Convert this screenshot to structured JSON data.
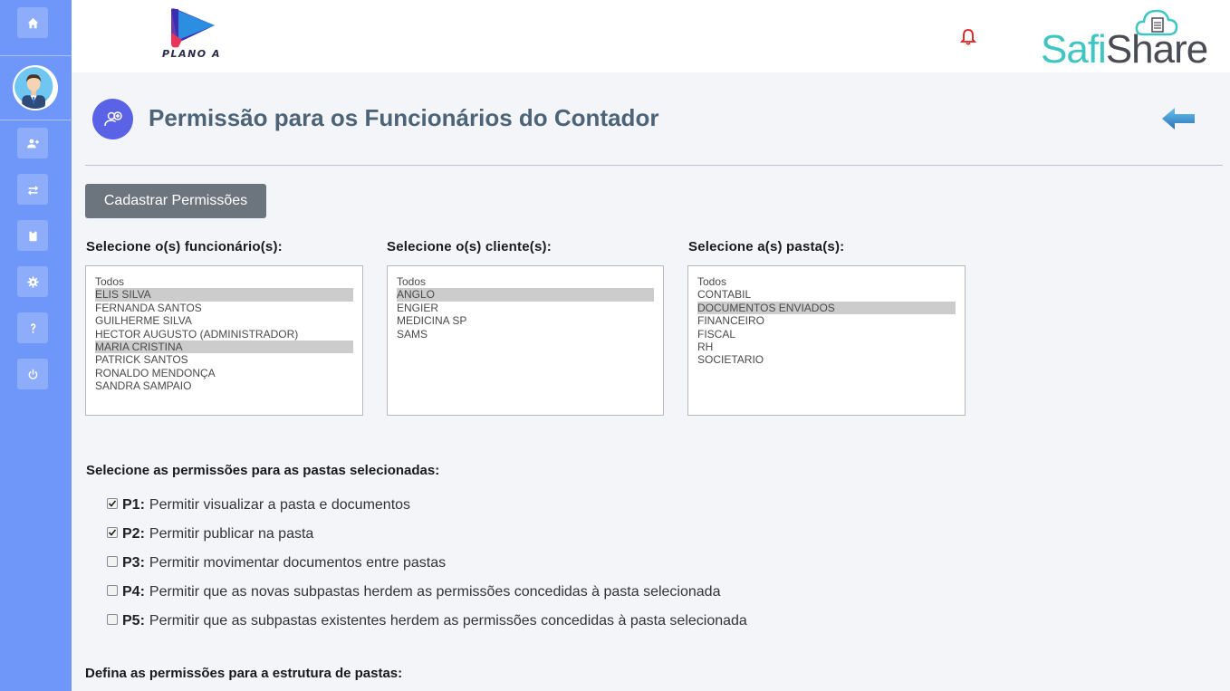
{
  "header": {
    "brand_left": "PLANO A",
    "brand_right_a": "Safi",
    "brand_right_b": "Share"
  },
  "sidebar": {
    "items": [
      {
        "icon": "home-icon"
      },
      {
        "icon": "add-user-icon"
      },
      {
        "icon": "transfer-icon"
      },
      {
        "icon": "clipboard-icon"
      },
      {
        "icon": "gear-icon"
      },
      {
        "icon": "question-icon"
      },
      {
        "icon": "power-icon"
      }
    ]
  },
  "page": {
    "title": "Permissão para os Funcionários do Contador",
    "register_button": "Cadastrar Permissões"
  },
  "employees": {
    "label": "Selecione o(s) funcionário(s):",
    "options": [
      {
        "text": "Todos",
        "selected": false
      },
      {
        "text": "ELIS SILVA",
        "selected": true
      },
      {
        "text": "FERNANDA SANTOS",
        "selected": false
      },
      {
        "text": "GUILHERME SILVA",
        "selected": false
      },
      {
        "text": "HECTOR AUGUSTO (ADMINISTRADOR)",
        "selected": false
      },
      {
        "text": "MARIA CRISTINA",
        "selected": true
      },
      {
        "text": "PATRICK SANTOS",
        "selected": false
      },
      {
        "text": "RONALDO MENDONÇA",
        "selected": false
      },
      {
        "text": "SANDRA SAMPAIO",
        "selected": false
      }
    ]
  },
  "clients": {
    "label": "Selecione o(s) cliente(s):",
    "options": [
      {
        "text": "Todos",
        "selected": false
      },
      {
        "text": "ANGLO",
        "selected": true
      },
      {
        "text": "ENGIER",
        "selected": false
      },
      {
        "text": "MEDICINA SP",
        "selected": false
      },
      {
        "text": "SAMS",
        "selected": false
      }
    ]
  },
  "folders": {
    "label": "Selecione a(s) pasta(s):",
    "options": [
      {
        "text": "Todos",
        "selected": false
      },
      {
        "text": "CONTABIL",
        "selected": false
      },
      {
        "text": "DOCUMENTOS ENVIADOS",
        "selected": true
      },
      {
        "text": "FINANCEIRO",
        "selected": false
      },
      {
        "text": "FISCAL",
        "selected": false
      },
      {
        "text": "RH",
        "selected": false
      },
      {
        "text": "SOCIETARIO",
        "selected": false
      }
    ]
  },
  "permissions": {
    "label": "Selecione as permissões para as pastas selecionadas:",
    "items": [
      {
        "code": "P1:",
        "text": "Permitir visualizar a pasta e documentos",
        "checked": true
      },
      {
        "code": "P2:",
        "text": "Permitir publicar na pasta",
        "checked": true
      },
      {
        "code": "P3:",
        "text": "Permitir movimentar documentos entre pastas",
        "checked": false
      },
      {
        "code": "P4:",
        "text": "Permitir que as novas subpastas herdem as permissões concedidas à pasta selecionada",
        "checked": false
      },
      {
        "code": "P5:",
        "text": "Permitir que as subpastas existentes herdem as permissões concedidas à pasta selecionada",
        "checked": false
      }
    ]
  },
  "structure": {
    "label": "Defina as permissões para a estrutura de pastas:"
  },
  "colors": {
    "sidebar": "#6e97f9",
    "title": "#4d6478",
    "accent": "#5a62e6",
    "button": "#6c757d"
  }
}
